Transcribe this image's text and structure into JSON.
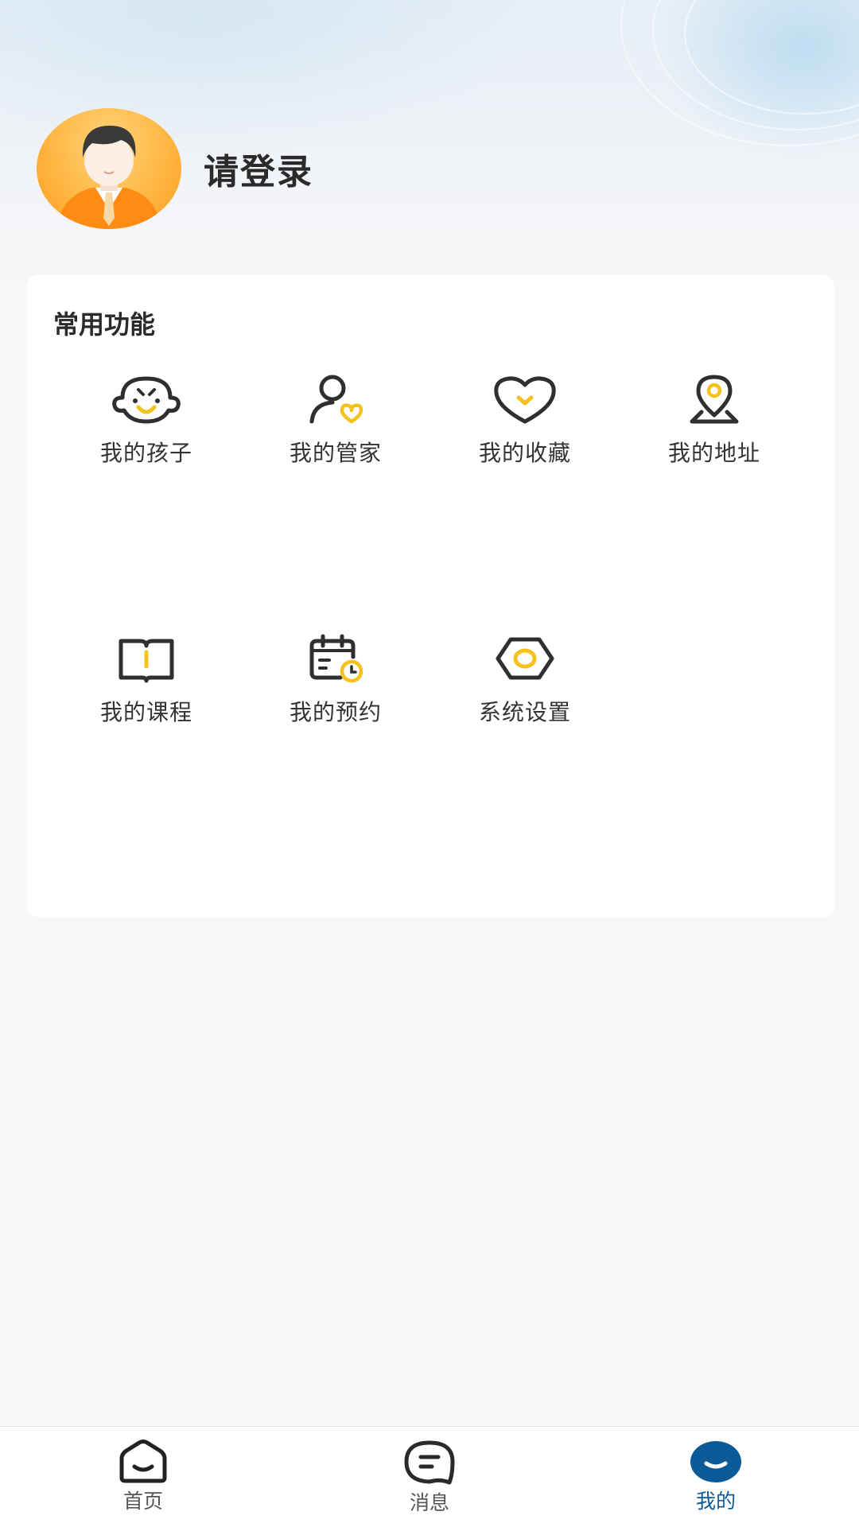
{
  "profile": {
    "login_prompt": "请登录",
    "avatar_icon": "avatar-icon"
  },
  "functions": {
    "title": "常用功能",
    "items": [
      {
        "label": "我的孩子",
        "icon": "child-face-icon"
      },
      {
        "label": "我的管家",
        "icon": "steward-icon"
      },
      {
        "label": "我的收藏",
        "icon": "heart-icon"
      },
      {
        "label": "我的地址",
        "icon": "location-pin-icon"
      },
      {
        "label": "我的课程",
        "icon": "book-icon"
      },
      {
        "label": "我的预约",
        "icon": "calendar-clock-icon"
      },
      {
        "label": "系统设置",
        "icon": "settings-hex-icon"
      }
    ]
  },
  "tabbar": {
    "tabs": [
      {
        "label": "首页",
        "icon": "home-icon",
        "active": false
      },
      {
        "label": "消息",
        "icon": "message-icon",
        "active": false
      },
      {
        "label": "我的",
        "icon": "profile-tab-icon",
        "active": true
      }
    ]
  },
  "colors": {
    "accent_yellow": "#f5c21b",
    "icon_dark": "#2f2f2f",
    "active_tab": "#0b5a98"
  }
}
